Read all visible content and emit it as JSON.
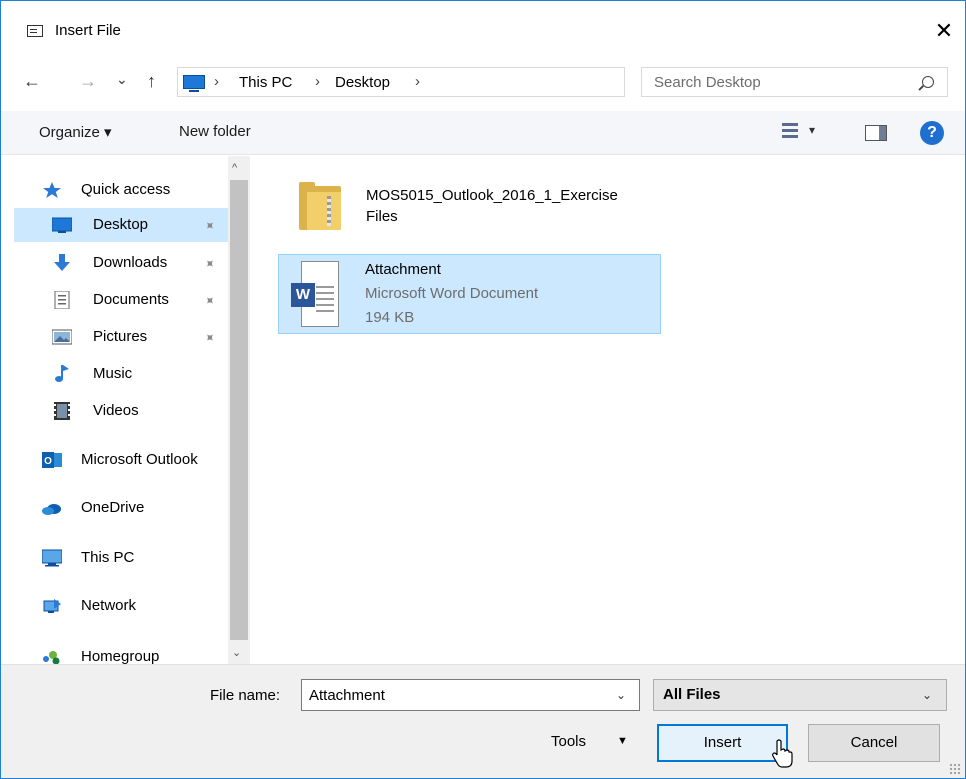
{
  "window": {
    "title": "Insert File",
    "close_glyph": "✕"
  },
  "address": {
    "back_glyph": "←",
    "forward_glyph": "→",
    "recent_glyph": "⌄",
    "up_glyph": "↑",
    "crumbs": [
      "This PC",
      "Desktop"
    ],
    "sep": "›",
    "dropdown_glyph": "⌄",
    "refresh_glyph": "↻"
  },
  "search": {
    "placeholder": "Search Desktop"
  },
  "command_bar": {
    "organize": "Organize ▾",
    "new_folder": "New folder",
    "view_dd": "▾",
    "help": "?"
  },
  "nav": {
    "items": [
      {
        "label": "Quick access",
        "icon": "star-icon"
      },
      {
        "label": "Desktop",
        "icon": "desktop-icon",
        "pinned": true,
        "selected": true
      },
      {
        "label": "Downloads",
        "icon": "download-icon",
        "pinned": true
      },
      {
        "label": "Documents",
        "icon": "documents-icon",
        "pinned": true
      },
      {
        "label": "Pictures",
        "icon": "pictures-icon",
        "pinned": true
      },
      {
        "label": "Music",
        "icon": "music-icon"
      },
      {
        "label": "Videos",
        "icon": "videos-icon"
      },
      {
        "label": "Microsoft Outlook",
        "icon": "outlook-icon"
      },
      {
        "label": "OneDrive",
        "icon": "onedrive-icon"
      },
      {
        "label": "This PC",
        "icon": "this-pc-icon"
      },
      {
        "label": "Network",
        "icon": "network-icon"
      },
      {
        "label": "Homegroup",
        "icon": "homegroup-icon"
      }
    ],
    "pin_glyph": "📌",
    "scroll_up": "^",
    "scroll_down": "⌄"
  },
  "files": [
    {
      "name_line1": "MOS5015_Outlook_2016_1_Exercise",
      "name_line2": "Files",
      "icon": "folder-icon"
    },
    {
      "name": "Attachment",
      "type": "Microsoft Word Document",
      "size": "194 KB",
      "icon": "word-document-icon",
      "selected": true
    }
  ],
  "bottom": {
    "file_name_label": "File name:",
    "file_name_value": "Attachment",
    "file_type": "All Files",
    "dd_glyph": "⌄",
    "tools": "Tools",
    "tools_dd": "▼",
    "insert": "Insert",
    "cancel": "Cancel"
  },
  "colors": {
    "accent": "#0078d7",
    "selection": "#cce8ff",
    "folder": "#dcb24a",
    "word": "#2b579a"
  }
}
